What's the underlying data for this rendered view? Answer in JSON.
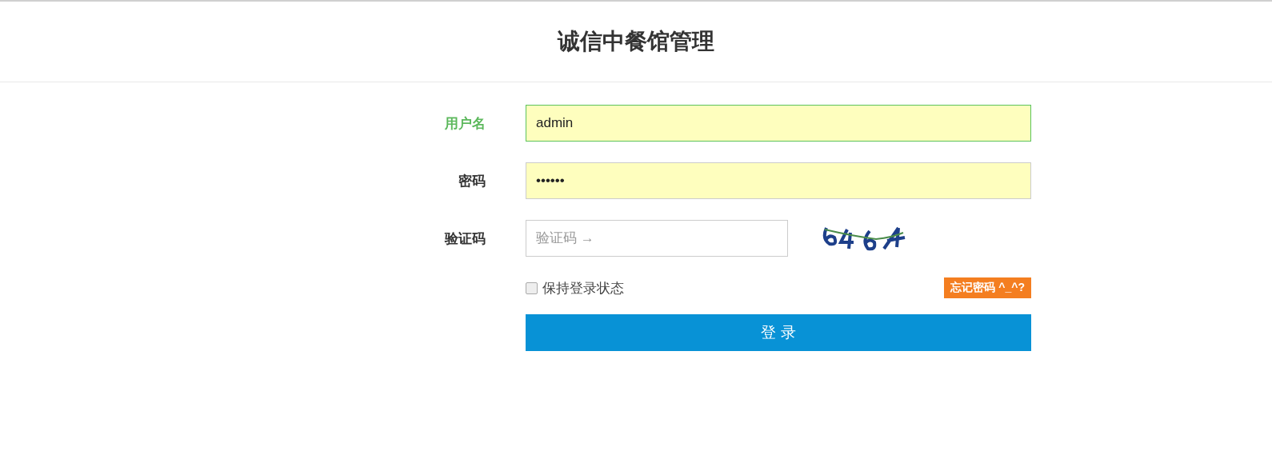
{
  "header": {
    "title": "诚信中餐馆管理"
  },
  "fields": [
    {
      "kind": "text",
      "label": "用户名",
      "value": "admin",
      "focused": true,
      "autofilled": true
    },
    {
      "kind": "password",
      "label": "密码",
      "value": "••••••",
      "focused": false,
      "autofilled": true
    },
    {
      "kind": "captcha",
      "label": "验证码",
      "placeholder": "验证码 →",
      "focused": false,
      "autofilled": false
    }
  ],
  "remember": {
    "label": "保持登录状态",
    "checked": false
  },
  "forgot_link": "忘记密码 ^_^?",
  "login_button": "登 录"
}
